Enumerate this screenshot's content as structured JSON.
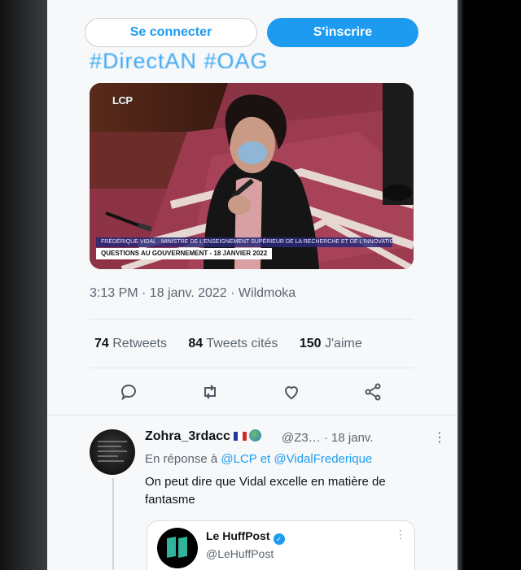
{
  "auth": {
    "login_label": "Se connecter",
    "signup_label": "S'inscrire"
  },
  "tweet": {
    "hashtags": "#DirectAN #QAG",
    "media": {
      "channel_logo": "LCP",
      "caption_top": "FRÉDÉRIQUE VIDAL · MINISTRE DE L'ENSEIGNEMENT SUPÉRIEUR DE LA RECHERCHE ET DE L'INNOVATION",
      "caption_bottom": "QUESTIONS AU GOUVERNEMENT - 18 JANVIER 2022"
    },
    "timestamp": "3:13 PM · 18 janv. 2022 · Wildmoka",
    "stats": {
      "retweets_count": "74",
      "retweets_label": "Retweets",
      "quotes_count": "84",
      "quotes_label": "Tweets cités",
      "likes_count": "150",
      "likes_label": "J'aime"
    },
    "actions": [
      "reply-icon",
      "retweet-icon",
      "like-icon",
      "share-icon"
    ]
  },
  "reply": {
    "name": "Zohra_3rdacc",
    "handle": "@Z3… · 18 janv.",
    "more": "⋮",
    "reply_prefix": "En réponse à",
    "mention_1": "@LCP",
    "conj": "et",
    "mention_2": "@VidalFrederique",
    "text": "On peut dire que Vidal excelle en matière de fantasme",
    "quote": {
      "name": "Le HuffPost",
      "handle": "@LeHuffPost",
      "more": "⋮"
    }
  },
  "colors": {
    "accent": "#1d9bf0",
    "text": "#0f1419",
    "muted": "#5b6570"
  }
}
